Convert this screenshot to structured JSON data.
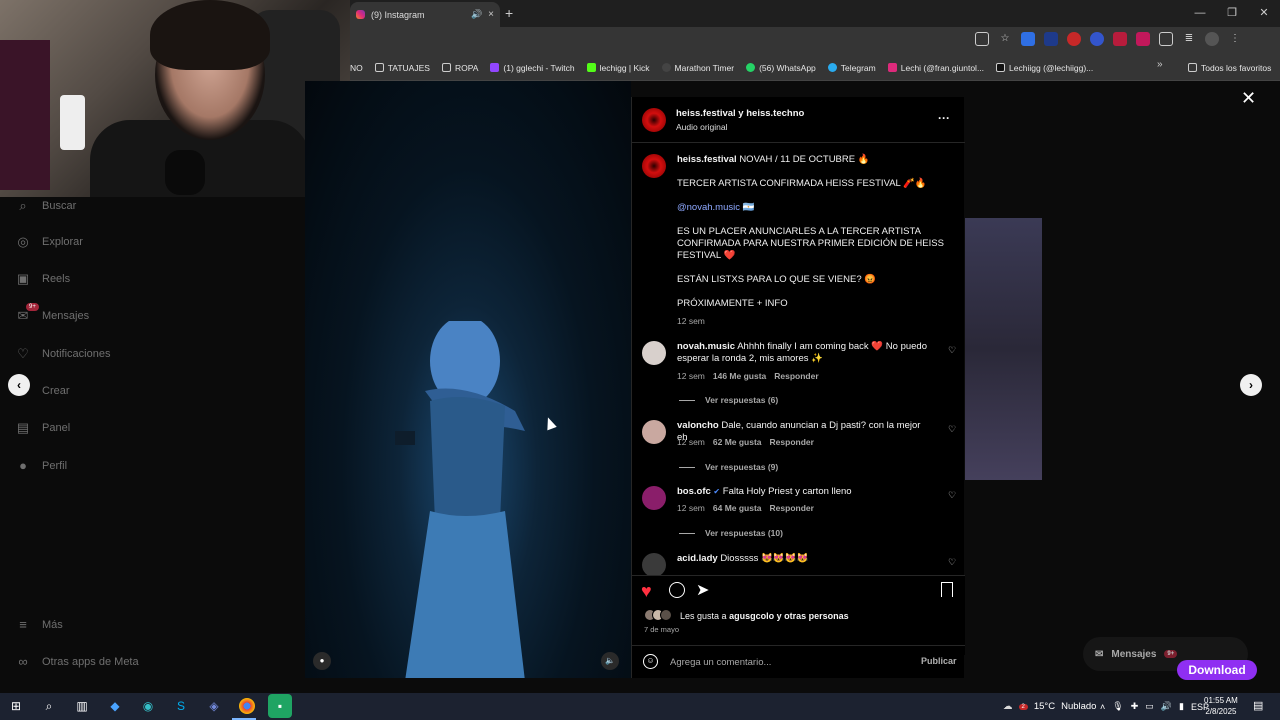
{
  "browser": {
    "tab_title": "(9) Instagram",
    "tab_close": "×",
    "tab_sound": "🔊",
    "new_tab": "+",
    "window_controls": [
      "—",
      "❐",
      "✕"
    ],
    "bookmarks": [
      {
        "label": "NO",
        "icon": "none",
        "color": ""
      },
      {
        "label": "TATUAJES",
        "icon": "folder-icon",
        "color": "#cccccc"
      },
      {
        "label": "ROPA",
        "icon": "folder-icon",
        "color": "#cccccc"
      },
      {
        "label": "(1) gglechi - Twitch",
        "icon": "twitch-icon",
        "color": "#9146ff"
      },
      {
        "label": "lechigg | Kick",
        "icon": "kick-icon",
        "color": "#53fc18"
      },
      {
        "label": "Marathon Timer",
        "icon": "timer-icon",
        "color": "#444444"
      },
      {
        "label": "(56) WhatsApp",
        "icon": "whatsapp-icon",
        "color": "#25d366"
      },
      {
        "label": "Telegram",
        "icon": "telegram-icon",
        "color": "#2aabee"
      },
      {
        "label": "Lechi (@fran.giuntol...",
        "icon": "instagram-icon",
        "color": "#dd2a7b"
      },
      {
        "label": "Lechiigg (@lechiigg)...",
        "icon": "tiktok-icon",
        "color": "#111111"
      }
    ],
    "bookmarks_more": "»",
    "all_bookmarks": "Todos los favoritos"
  },
  "sidebar": {
    "items": [
      {
        "label": "Buscar",
        "icon": "⌕"
      },
      {
        "label": "Explorar",
        "icon": "◎"
      },
      {
        "label": "Reels",
        "icon": "▣"
      },
      {
        "label": "Mensajes",
        "icon": "✉"
      },
      {
        "label": "Notificaciones",
        "icon": "♡"
      },
      {
        "label": "Crear",
        "icon": "⊕"
      },
      {
        "label": "Panel",
        "icon": "▤"
      },
      {
        "label": "Perfil",
        "icon": "●"
      }
    ],
    "messages_badge": "9+",
    "more": {
      "label": "Más",
      "icon": "≡"
    },
    "meta": {
      "label": "Otras apps de Meta",
      "icon": "∞"
    }
  },
  "post": {
    "header_names": "heiss.festival y heiss.techno",
    "header_audio": "Audio original",
    "more": "···",
    "caption_user": "heiss.festival",
    "caption_lines": [
      "NOVAH / 11 DE OCTUBRE 🔥",
      "TERCER ARTISTA CONFIRMADA HEISS FESTIVAL 🧨🔥",
      "ES UN PLACER ANUNCIARLES A LA TERCER ARTISTA CONFIRMADA PARA NUESTRA PRIMER EDICIÓN DE HEISS FESTIVAL ❤️",
      "ESTÁN LISTXS PARA LO QUE SE VIENE? 😡",
      "PRÓXIMAMENTE + INFO"
    ],
    "caption_mention": "@novah.music 🇦🇷",
    "caption_time": "12 sem",
    "comments": [
      {
        "user": "novah.music",
        "text": "Ahhhh finally I am coming back ❤️ No puedo esperar la ronda 2, mis amores ✨",
        "time": "12 sem",
        "likes": "146 Me gusta",
        "reply": "Responder",
        "replies": "Ver respuestas (6)",
        "avatar_color": "#d8d0cc"
      },
      {
        "user": "valoncho",
        "text": "Dale, cuando anuncian a Dj pasti? con la mejor eh",
        "time": "12 sem",
        "likes": "62 Me gusta",
        "reply": "Responder",
        "replies": "Ver respuestas (9)",
        "avatar_color": "#c9a8a0"
      },
      {
        "user": "bos.ofc",
        "text": "Falta Holy Priest y carton lleno",
        "time": "12 sem",
        "likes": "64 Me gusta",
        "reply": "Responder",
        "replies": "Ver respuestas (10)",
        "avatar_color": "#8a1e6a",
        "verified": true
      },
      {
        "user": "acid.lady",
        "text": "Diosssss 😻😻😻😻",
        "time": "",
        "likes": "",
        "reply": "",
        "replies": "",
        "avatar_color": "#3a3a3a"
      }
    ],
    "likes_prefix": "Les gusta a",
    "likes_user": "agusgcolo",
    "likes_suffix": "y otras personas",
    "date": "7 de mayo",
    "comment_placeholder": "Agrega un comentario...",
    "publish": "Publicar",
    "verified_mark": "✔"
  },
  "overlay": {
    "messages_label": "Mensajes",
    "messages_badge": "9+",
    "download_label": "Download",
    "prev": "‹",
    "next": "›",
    "close": "✕"
  },
  "taskbar": {
    "weather_temp": "15°C",
    "weather_desc": "Nublado",
    "weather_badge": "2",
    "language": "ESP",
    "time": "01:55 AM",
    "date": "2/8/2025"
  },
  "colors": {
    "like_red": "#ff3040",
    "link_blue": "#8ea8ff",
    "download_purple": "#8f2ff2"
  }
}
